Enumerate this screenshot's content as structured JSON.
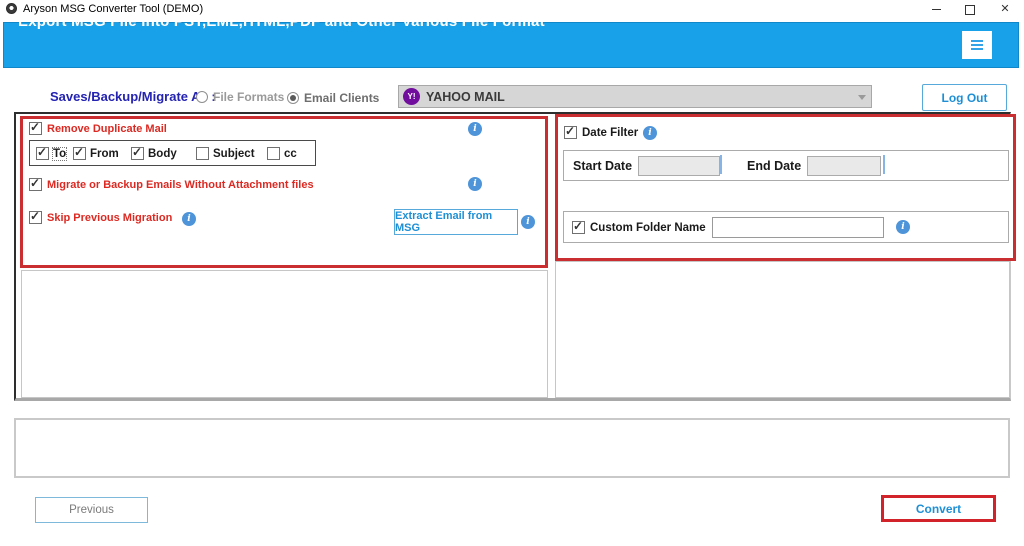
{
  "window": {
    "title": "Aryson MSG Converter Tool (DEMO)"
  },
  "header": {
    "title": "Export MSG File into PST,EML,HTML,PDF and Other Various File Format"
  },
  "mode_bar": {
    "label": "Saves/Backup/Migrate As :",
    "file_formats": {
      "label": "File Formats",
      "selected": false
    },
    "email_clients": {
      "label": "Email Clients",
      "selected": true
    },
    "client_dropdown": {
      "value": "YAHOO MAIL",
      "icon_text": "Y!"
    },
    "logout_label": "Log Out"
  },
  "left_panel": {
    "remove_duplicate": {
      "label": "Remove Duplicate Mail",
      "checked": true
    },
    "dedupe_fields": [
      {
        "label": "To",
        "checked": true,
        "focused": true
      },
      {
        "label": "From",
        "checked": true
      },
      {
        "label": "Body",
        "checked": true
      },
      {
        "label": "Subject",
        "checked": false
      },
      {
        "label": "cc",
        "checked": false
      }
    ],
    "without_attachment": {
      "label": "Migrate or Backup Emails Without Attachment files",
      "checked": true
    },
    "skip_previous": {
      "label": "Skip Previous Migration",
      "checked": true
    },
    "extract_button_label": "Extract Email from MSG"
  },
  "right_panel": {
    "date_filter": {
      "label": "Date Filter",
      "checked": true
    },
    "start_date": {
      "label": "Start Date",
      "value": ""
    },
    "end_date": {
      "label": "End Date",
      "value": ""
    },
    "custom_folder": {
      "label": "Custom Folder Name",
      "checked": true,
      "value": ""
    }
  },
  "status_box": {
    "text": ""
  },
  "footer": {
    "previous_label": "Previous",
    "convert_label": "Convert"
  },
  "colors": {
    "header_blue": "#18A0E8",
    "accent_red": "#CB2E31",
    "navy": "#2423B2",
    "info_blue": "#4E94D8",
    "link_blue": "#1E8FD5",
    "yahoo_purple": "#720E9E"
  }
}
